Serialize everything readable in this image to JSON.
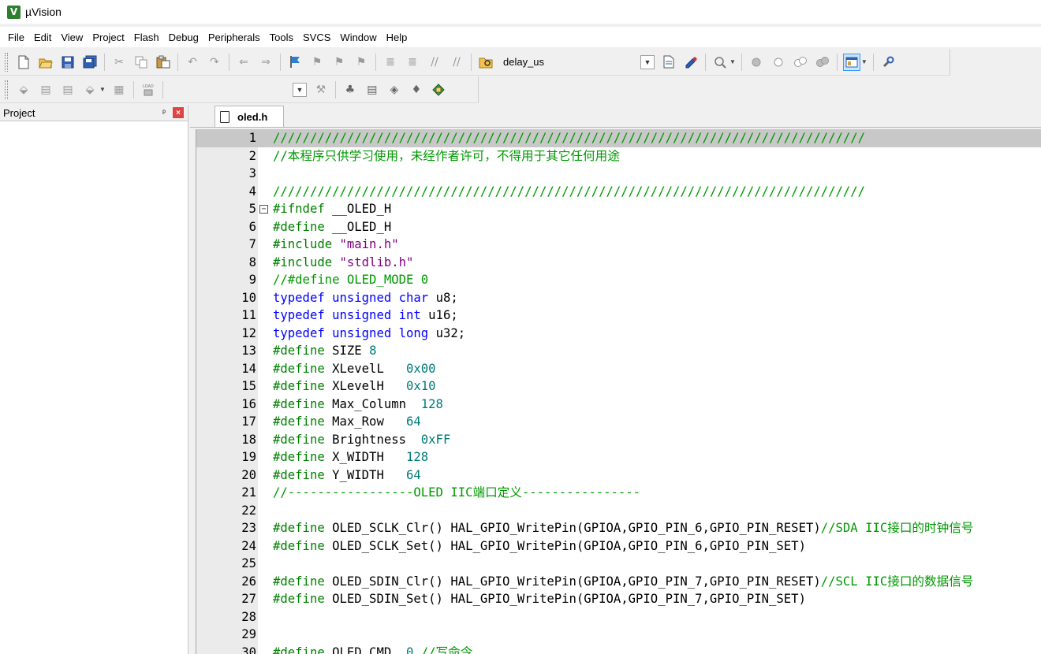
{
  "window": {
    "title": "µVision"
  },
  "menu": [
    "File",
    "Edit",
    "View",
    "Project",
    "Flash",
    "Debug",
    "Peripherals",
    "Tools",
    "SVCS",
    "Window",
    "Help"
  ],
  "toolbar": {
    "target_name": "delay_us"
  },
  "project_panel": {
    "title": "Project"
  },
  "editor": {
    "active_tab": "oled.h",
    "lines": [
      {
        "n": "1",
        "tokens": [
          {
            "t": "////////////////////////////////////////////////////////////////////////////////",
            "c": "comment"
          }
        ]
      },
      {
        "n": "2",
        "tokens": [
          {
            "t": "//本程序只供学习使用，未经作者许可，不得用于其它任何用途",
            "c": "comment"
          }
        ]
      },
      {
        "n": "3",
        "tokens": []
      },
      {
        "n": "4",
        "tokens": [
          {
            "t": "////////////////////////////////////////////////////////////////////////////////",
            "c": "comment"
          }
        ]
      },
      {
        "n": "5",
        "tokens": [
          {
            "t": "#ifndef ",
            "c": "pp"
          },
          {
            "t": "__OLED_H",
            "c": "plain"
          }
        ]
      },
      {
        "n": "6",
        "tokens": [
          {
            "t": "#define ",
            "c": "pp"
          },
          {
            "t": "__OLED_H",
            "c": "plain"
          }
        ]
      },
      {
        "n": "7",
        "tokens": [
          {
            "t": "#include ",
            "c": "pp"
          },
          {
            "t": "\"main.h\"",
            "c": "str"
          }
        ]
      },
      {
        "n": "8",
        "tokens": [
          {
            "t": "#include ",
            "c": "pp"
          },
          {
            "t": "\"stdlib.h\"",
            "c": "str"
          }
        ]
      },
      {
        "n": "9",
        "tokens": [
          {
            "t": "//#define OLED_MODE 0",
            "c": "comment"
          }
        ]
      },
      {
        "n": "10",
        "tokens": [
          {
            "t": "typedef ",
            "c": "kw"
          },
          {
            "t": "unsigned ",
            "c": "kw"
          },
          {
            "t": "char ",
            "c": "kw"
          },
          {
            "t": "u8;",
            "c": "plain"
          }
        ]
      },
      {
        "n": "11",
        "tokens": [
          {
            "t": "typedef ",
            "c": "kw"
          },
          {
            "t": "unsigned ",
            "c": "kw"
          },
          {
            "t": "int ",
            "c": "kw"
          },
          {
            "t": "u16;",
            "c": "plain"
          }
        ]
      },
      {
        "n": "12",
        "tokens": [
          {
            "t": "typedef ",
            "c": "kw"
          },
          {
            "t": "unsigned ",
            "c": "kw"
          },
          {
            "t": "long ",
            "c": "kw"
          },
          {
            "t": "u32;",
            "c": "plain"
          }
        ]
      },
      {
        "n": "13",
        "tokens": [
          {
            "t": "#define ",
            "c": "pp"
          },
          {
            "t": "SIZE ",
            "c": "plain"
          },
          {
            "t": "8",
            "c": "num"
          }
        ]
      },
      {
        "n": "14",
        "tokens": [
          {
            "t": "#define ",
            "c": "pp"
          },
          {
            "t": "XLevelL   ",
            "c": "plain"
          },
          {
            "t": "0x00",
            "c": "num"
          }
        ]
      },
      {
        "n": "15",
        "tokens": [
          {
            "t": "#define ",
            "c": "pp"
          },
          {
            "t": "XLevelH   ",
            "c": "plain"
          },
          {
            "t": "0x10",
            "c": "num"
          }
        ]
      },
      {
        "n": "16",
        "tokens": [
          {
            "t": "#define ",
            "c": "pp"
          },
          {
            "t": "Max_Column  ",
            "c": "plain"
          },
          {
            "t": "128",
            "c": "num"
          }
        ]
      },
      {
        "n": "17",
        "tokens": [
          {
            "t": "#define ",
            "c": "pp"
          },
          {
            "t": "Max_Row   ",
            "c": "plain"
          },
          {
            "t": "64",
            "c": "num"
          }
        ]
      },
      {
        "n": "18",
        "tokens": [
          {
            "t": "#define ",
            "c": "pp"
          },
          {
            "t": "Brightness  ",
            "c": "plain"
          },
          {
            "t": "0xFF",
            "c": "num"
          }
        ]
      },
      {
        "n": "19",
        "tokens": [
          {
            "t": "#define ",
            "c": "pp"
          },
          {
            "t": "X_WIDTH   ",
            "c": "plain"
          },
          {
            "t": "128",
            "c": "num"
          }
        ]
      },
      {
        "n": "20",
        "tokens": [
          {
            "t": "#define ",
            "c": "pp"
          },
          {
            "t": "Y_WIDTH   ",
            "c": "plain"
          },
          {
            "t": "64",
            "c": "num"
          }
        ]
      },
      {
        "n": "21",
        "tokens": [
          {
            "t": "//-----------------OLED IIC端口定义----------------",
            "c": "comment"
          }
        ]
      },
      {
        "n": "22",
        "tokens": []
      },
      {
        "n": "23",
        "tokens": [
          {
            "t": "#define ",
            "c": "pp"
          },
          {
            "t": "OLED_SCLK_Clr() HAL_GPIO_WritePin(GPIOA,GPIO_PIN_6,GPIO_PIN_RESET)",
            "c": "plain"
          },
          {
            "t": "//SDA IIC接口的时钟信号",
            "c": "comment"
          }
        ]
      },
      {
        "n": "24",
        "tokens": [
          {
            "t": "#define ",
            "c": "pp"
          },
          {
            "t": "OLED_SCLK_Set() HAL_GPIO_WritePin(GPIOA,GPIO_PIN_6,GPIO_PIN_SET)",
            "c": "plain"
          }
        ]
      },
      {
        "n": "25",
        "tokens": []
      },
      {
        "n": "26",
        "tokens": [
          {
            "t": "#define ",
            "c": "pp"
          },
          {
            "t": "OLED_SDIN_Clr() HAL_GPIO_WritePin(GPIOA,GPIO_PIN_7,GPIO_PIN_RESET)",
            "c": "plain"
          },
          {
            "t": "//SCL IIC接口的数据信号",
            "c": "comment"
          }
        ]
      },
      {
        "n": "27",
        "tokens": [
          {
            "t": "#define ",
            "c": "pp"
          },
          {
            "t": "OLED_SDIN_Set() HAL_GPIO_WritePin(GPIOA,GPIO_PIN_7,GPIO_PIN_SET)",
            "c": "plain"
          }
        ]
      },
      {
        "n": "28",
        "tokens": []
      },
      {
        "n": "29",
        "tokens": []
      },
      {
        "n": "30",
        "tokens": [
          {
            "t": "#define ",
            "c": "pp"
          },
          {
            "t": "OLED_CMD  ",
            "c": "plain"
          },
          {
            "t": "0 ",
            "c": "num"
          },
          {
            "t": "//写命令",
            "c": "comment"
          }
        ]
      }
    ]
  },
  "colors": {
    "comment": "#009900",
    "preprocessor": "#008000",
    "keyword": "#0000ff",
    "string": "#800080",
    "number": "#007a7a",
    "current_line": "#c8c8c8",
    "gutter": "#ebebeb"
  },
  "icons": {
    "toolbar1": [
      "new-file-icon",
      "open-folder-icon",
      "save-icon",
      "save-all-icon",
      "cut-icon",
      "copy-icon",
      "paste-icon",
      "undo-icon",
      "redo-icon",
      "navigate-back-icon",
      "navigate-forward-icon",
      "bookmark-flag-icon",
      "bookmark-prev-icon",
      "bookmark-next-icon",
      "bookmark-clear-icon",
      "indent-icon",
      "unindent-icon",
      "comment-icon",
      "uncomment-icon",
      "find-in-files-icon",
      "target-dropdown-icon",
      "insert-template-icon",
      "configure-icon",
      "zoom-icon",
      "breakpoint-icon",
      "breakpoint-disable-icon",
      "breakpoint-remove-icon",
      "breakpoint-kill-icon",
      "window-layout-icon",
      "wrench-icon"
    ],
    "toolbar2": [
      "translate-icon",
      "build-icon",
      "rebuild-icon",
      "batch-build-icon",
      "stop-build-icon",
      "download-icon",
      "target-options-icon",
      "manage-components-icon",
      "pack-installer-icon",
      "select-packs-icon",
      "software-components-icon"
    ]
  }
}
